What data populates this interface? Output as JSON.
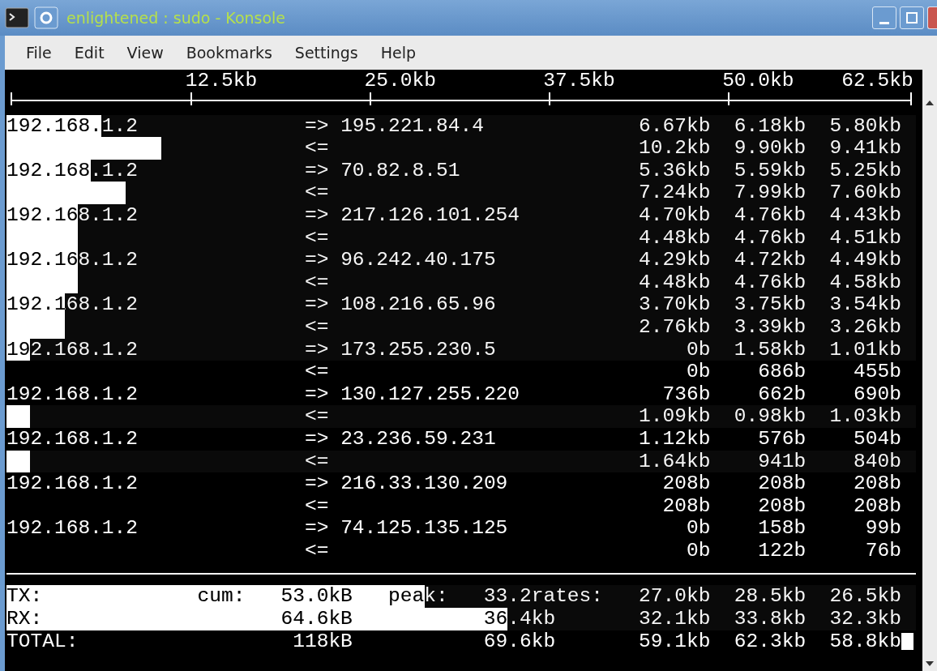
{
  "window": {
    "title": "enlightened : sudo - Konsole"
  },
  "menu_bar": [
    "File",
    "Edit",
    "View",
    "Bookmarks",
    "Settings",
    "Help"
  ],
  "scale": [
    "12.5kb",
    "25.0kb",
    "37.5kb",
    "50.0kb",
    "62.5kb"
  ],
  "connections": [
    {
      "host": "192.168.1.2",
      "remote": "195.221.84.4",
      "sent": {
        "arrow": "=>",
        "rates": [
          "6.67kb",
          "6.18kb",
          "5.80kb"
        ],
        "level": 0.104
      },
      "received": {
        "arrow": "<=",
        "rates": [
          "10.2kb",
          "9.90kb",
          "9.41kb"
        ],
        "level": 0.17
      }
    },
    {
      "host": "192.168.1.2",
      "remote": "70.82.8.51",
      "sent": {
        "arrow": "=>",
        "rates": [
          "5.36kb",
          "5.59kb",
          "5.25kb"
        ],
        "level": 0.093
      },
      "received": {
        "arrow": "<=",
        "rates": [
          "7.24kb",
          "7.99kb",
          "7.60kb"
        ],
        "level": 0.131
      }
    },
    {
      "host": "192.168.1.2",
      "remote": "217.126.101.254",
      "sent": {
        "arrow": "=>",
        "rates": [
          "4.70kb",
          "4.76kb",
          "4.43kb"
        ],
        "level": 0.078
      },
      "received": {
        "arrow": "<=",
        "rates": [
          "4.48kb",
          "4.76kb",
          "4.51kb"
        ],
        "level": 0.078
      }
    },
    {
      "host": "192.168.1.2",
      "remote": "96.242.40.175",
      "sent": {
        "arrow": "=>",
        "rates": [
          "4.29kb",
          "4.72kb",
          "4.49kb"
        ],
        "level": 0.078
      },
      "received": {
        "arrow": "<=",
        "rates": [
          "4.48kb",
          "4.76kb",
          "4.58kb"
        ],
        "level": 0.078
      }
    },
    {
      "host": "192.168.1.2",
      "remote": "108.216.65.96",
      "sent": {
        "arrow": "=>",
        "rates": [
          "3.70kb",
          "3.75kb",
          "3.54kb"
        ],
        "level": 0.064
      },
      "received": {
        "arrow": "<=",
        "rates": [
          "2.76kb",
          "3.39kb",
          "3.26kb"
        ],
        "level": 0.064
      }
    },
    {
      "host": "192.168.1.2",
      "remote": "173.255.230.5",
      "sent": {
        "arrow": "=>",
        "rates": [
          "0b",
          "1.58kb",
          "1.01kb"
        ],
        "level": 0.026
      },
      "received": {
        "arrow": "<=",
        "rates": [
          "0b",
          "686b",
          "455b"
        ]
      }
    },
    {
      "host": "192.168.1.2",
      "remote": "130.127.255.220",
      "sent": {
        "arrow": "=>",
        "rates": [
          "736b",
          "662b",
          "690b"
        ]
      },
      "received": {
        "arrow": "<=",
        "rates": [
          "1.09kb",
          "0.98kb",
          "1.03kb"
        ],
        "level": 0.026
      }
    },
    {
      "host": "192.168.1.2",
      "remote": "23.236.59.231",
      "sent": {
        "arrow": "=>",
        "rates": [
          "1.12kb",
          "576b",
          "504b"
        ]
      },
      "received": {
        "arrow": "<=",
        "rates": [
          "1.64kb",
          "941b",
          "840b"
        ],
        "level": 0.026
      }
    },
    {
      "host": "192.168.1.2",
      "remote": "216.33.130.209",
      "sent": {
        "arrow": "=>",
        "rates": [
          "208b",
          "208b",
          "208b"
        ]
      },
      "received": {
        "arrow": "<=",
        "rates": [
          "208b",
          "208b",
          "208b"
        ]
      }
    },
    {
      "host": "192.168.1.2",
      "remote": "74.125.135.125",
      "sent": {
        "arrow": "=>",
        "rates": [
          "0b",
          "158b",
          "99b"
        ]
      },
      "received": {
        "arrow": "<=",
        "rates": [
          "0b",
          "122b",
          "76b"
        ]
      }
    }
  ],
  "totals": [
    {
      "label": "TX:",
      "cum_label": "cum:",
      "cum": "53.0kB",
      "peak_label": "peak:",
      "peak": "33.2rates:",
      "rates": [
        "27.0kb",
        "28.5kb",
        "26.5kb"
      ],
      "level": 0.46
    },
    {
      "label": "RX:",
      "cum": "64.6kB",
      "peak": "36.4kb",
      "rates": [
        "32.1kb",
        "33.8kb",
        "32.3kb"
      ],
      "level": 0.551
    },
    {
      "label": "TOTAL:",
      "cum": "118kB",
      "peak": "69.6kb",
      "rates": [
        "59.1kb",
        "62.3kb",
        "58.8kb"
      ]
    }
  ]
}
